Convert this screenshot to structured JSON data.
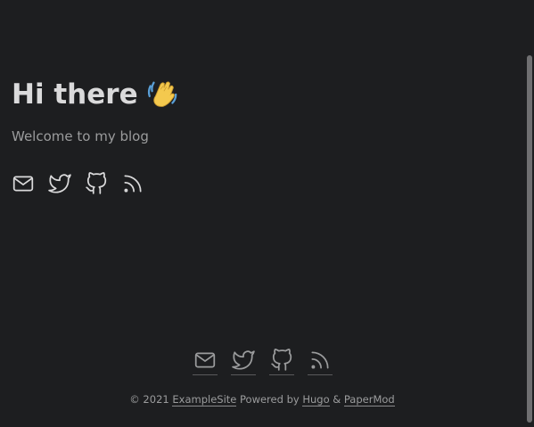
{
  "hero": {
    "title": "Hi there",
    "emoji": "waving-hand-icon",
    "subtitle": "Welcome to my blog"
  },
  "social_icons": [
    "email-icon",
    "twitter-icon",
    "github-icon",
    "rss-icon"
  ],
  "footer": {
    "copyright": "© 2021",
    "site_link": "ExampleSite",
    "powered_by": "Powered by",
    "hugo_link": "Hugo",
    "ampersand": "&",
    "theme_link": "PaperMod"
  },
  "colors": {
    "background": "#1d1e20",
    "primary_text": "#dadadb",
    "secondary_text": "#9b9c9d",
    "emoji_yellow": "#f4c94e",
    "emoji_blue": "#5aa0d8"
  }
}
